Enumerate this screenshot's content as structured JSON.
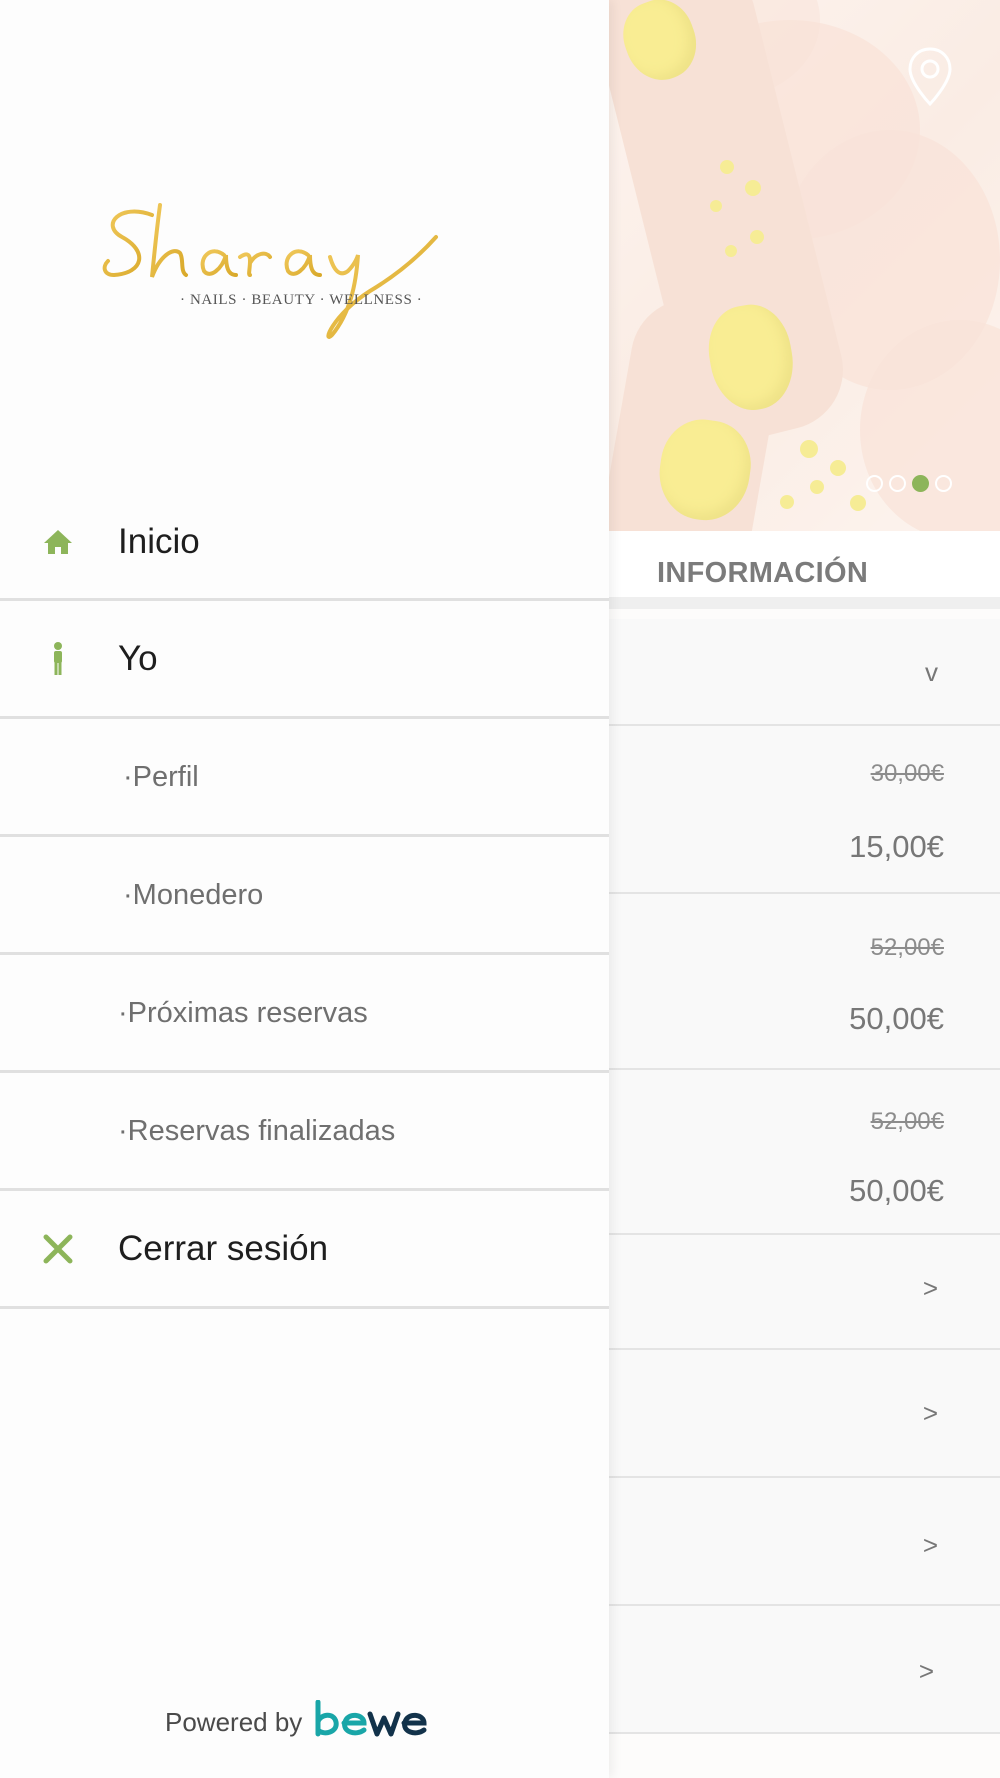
{
  "drawer": {
    "brand": {
      "logo_script": "Sharay",
      "tagline": "· NAILS · BEAUTY · WELLNESS ·"
    },
    "menu": [
      {
        "label": "Inicio",
        "icon": "home-icon"
      },
      {
        "label": "Yo",
        "icon": "person-icon"
      },
      {
        "label": "·Perfil"
      },
      {
        "label": "·Monedero"
      },
      {
        "label": "·Próximas reservas"
      },
      {
        "label": "·Reservas finalizadas"
      },
      {
        "label": "Cerrar sesión",
        "icon": "close-icon"
      }
    ],
    "powered_by": {
      "text": "Powered by",
      "logo": "bewe"
    }
  },
  "page": {
    "hero": {
      "icon": "location-pin-icon",
      "carousel_total": 4,
      "carousel_active": 3
    },
    "section_title": "INFORMACIÓN",
    "dropdown_symbol": "v",
    "prices": [
      {
        "old": "30,00€",
        "new": "15,00€"
      },
      {
        "old": "52,00€",
        "new": "50,00€"
      },
      {
        "old": "52,00€",
        "new": "50,00€"
      }
    ],
    "link_rows": [
      ">",
      ">",
      ">",
      ">"
    ]
  },
  "colors": {
    "accent_green": "#8db55a",
    "logo_gold": "#e4b73a",
    "bewe_teal": "#19a6a8",
    "bewe_navy": "#12324a"
  }
}
